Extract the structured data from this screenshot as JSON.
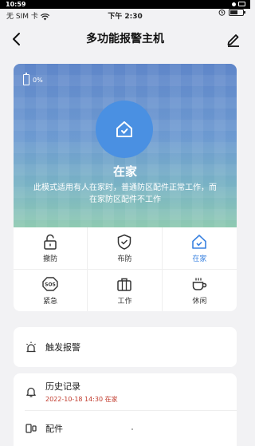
{
  "topbar": {
    "time": "10:59"
  },
  "statusbar": {
    "carrier": "无 SIM 卡",
    "time": "下午 2:30"
  },
  "navbar": {
    "title": "多功能报警主机"
  },
  "hero": {
    "battery_text": "0%",
    "mode": "在家",
    "description": "此模式适用有人在家时，普通防区配件正常工作，而在家防区配件不工作"
  },
  "modes": [
    {
      "label": "撤防",
      "icon": "unlock-icon",
      "active": false
    },
    {
      "label": "布防",
      "icon": "shield-check-icon",
      "active": false
    },
    {
      "label": "在家",
      "icon": "home-icon",
      "active": true
    },
    {
      "label": "紧急",
      "icon": "sos-icon",
      "active": false
    },
    {
      "label": "工作",
      "icon": "briefcase-icon",
      "active": false
    },
    {
      "label": "休闲",
      "icon": "coffee-icon",
      "active": false
    }
  ],
  "trigger": {
    "label": "触发报警"
  },
  "history": {
    "label": "历史记录",
    "latest": "2022-10-18 14:30 在家"
  },
  "parts": {
    "label": "配件"
  },
  "colors": {
    "accent": "#3a82e0",
    "hero_circle": "#4a90e2",
    "history_date": "#c0392b"
  }
}
